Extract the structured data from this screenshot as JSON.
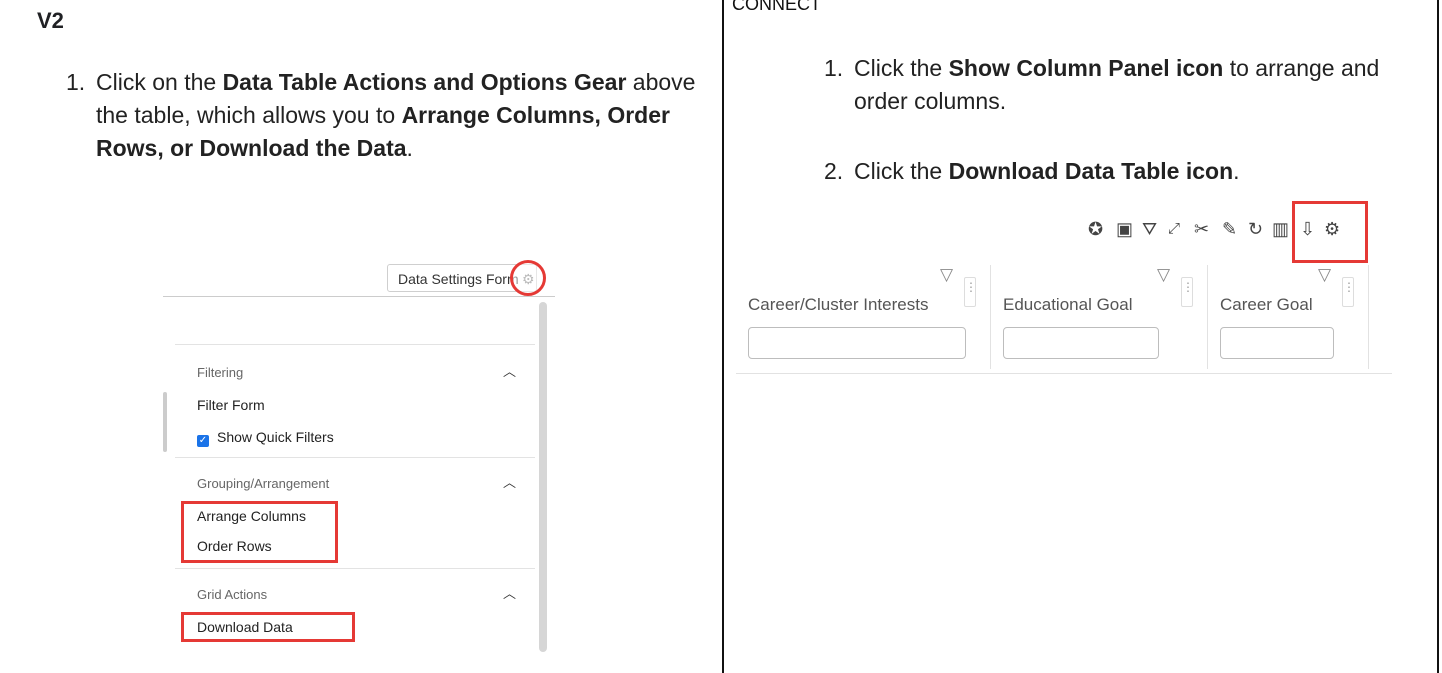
{
  "left": {
    "title": "V2",
    "step1": {
      "number": "1.",
      "parts": [
        {
          "t": "Click on the ",
          "b": false
        },
        {
          "t": "Data Table Actions and Options Gear",
          "b": true
        },
        {
          "t": " above the table, which allows you to ",
          "b": false
        },
        {
          "t": "Arrange Columns, Order Rows, or Download the Data",
          "b": true
        },
        {
          "t": ".",
          "b": false
        }
      ]
    },
    "panel": {
      "settings_button": "Data Settings Form",
      "sections": [
        {
          "heading": "Filtering",
          "items": [
            "Filter Form",
            "Show Quick Filters"
          ]
        },
        {
          "heading": "Grouping/Arrangement",
          "items": [
            "Arrange Columns",
            "Order Rows"
          ]
        },
        {
          "heading": "Grid Actions",
          "items": [
            "Download Data"
          ]
        }
      ],
      "highlight_color": "#e53935",
      "checkbox_color": "#1a73e8",
      "caret_icon": "chevron-up-icon",
      "gear_icon": "gear-icon"
    }
  },
  "right": {
    "title": "CONNECT",
    "step1": {
      "number": "1.",
      "parts": [
        {
          "t": "Click the ",
          "b": false
        },
        {
          "t": "Show Column Panel icon",
          "b": true
        },
        {
          "t": " to arrange and order columns.",
          "b": false
        }
      ]
    },
    "step2": {
      "number": "2.",
      "parts": [
        {
          "t": "Click the ",
          "b": false
        },
        {
          "t": "Download Data Table icon",
          "b": true
        },
        {
          "t": ".",
          "b": false
        }
      ]
    },
    "toolbar_icons": [
      "puzzle-icon",
      "save-icon",
      "filter-list-icon",
      "expand-icon",
      "tools-icon",
      "magic-wand-icon",
      "refresh-icon",
      "columns-icon",
      "download-icon",
      "gear-icon"
    ],
    "grid": {
      "columns": [
        "Career/Cluster Interests",
        "Educational Goal",
        "Career Goal"
      ]
    }
  }
}
